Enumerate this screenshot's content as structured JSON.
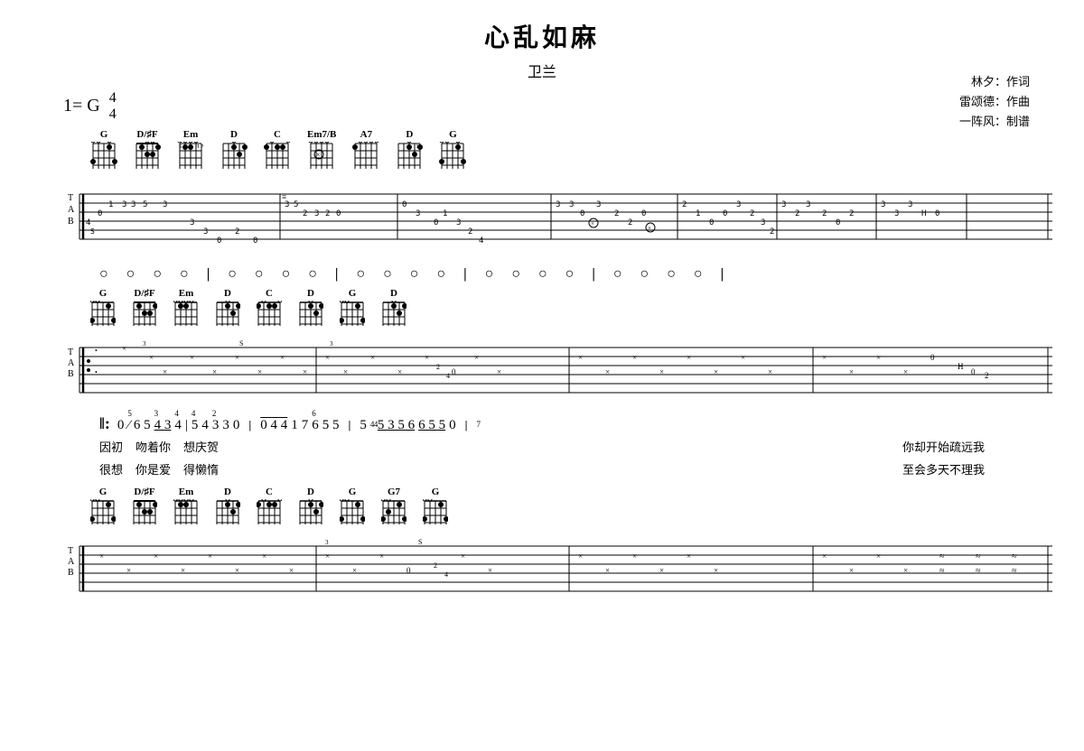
{
  "title": "心乱如麻",
  "subtitle": "卫兰",
  "credits": {
    "lyricist": "林夕：作词",
    "composer": "雷颂德：作曲",
    "transcriber": "一阵风：制谱"
  },
  "key": {
    "tonic": "1= G",
    "time_top": "4",
    "time_bottom": "4"
  },
  "sections": [
    {
      "id": "section1",
      "chords": [
        "G",
        "D/#F",
        "Em",
        "D",
        "C",
        "Em7/B",
        "A7",
        "D",
        "G"
      ],
      "has_tab": true
    },
    {
      "id": "section2",
      "chords": [
        "G",
        "D/#F",
        "Em",
        "D",
        "C",
        "D",
        "G",
        "D"
      ],
      "has_tab": true,
      "notation": "0 ⁵⁄₆5 ³⁄₄34 ⁴⁄₅4 ²⁄₃30 | 0441 7655 5 5356 6550",
      "lyrics_line1": "因初  吻着你  想庆贺        你却开始疏远我",
      "lyrics_line2": "很想  你是爱  得懒惰        至会多天不理我"
    },
    {
      "id": "section3",
      "chords": [
        "G",
        "D/#F",
        "Em",
        "D",
        "C",
        "D",
        "G",
        "G7",
        "G"
      ],
      "has_tab": true
    }
  ]
}
